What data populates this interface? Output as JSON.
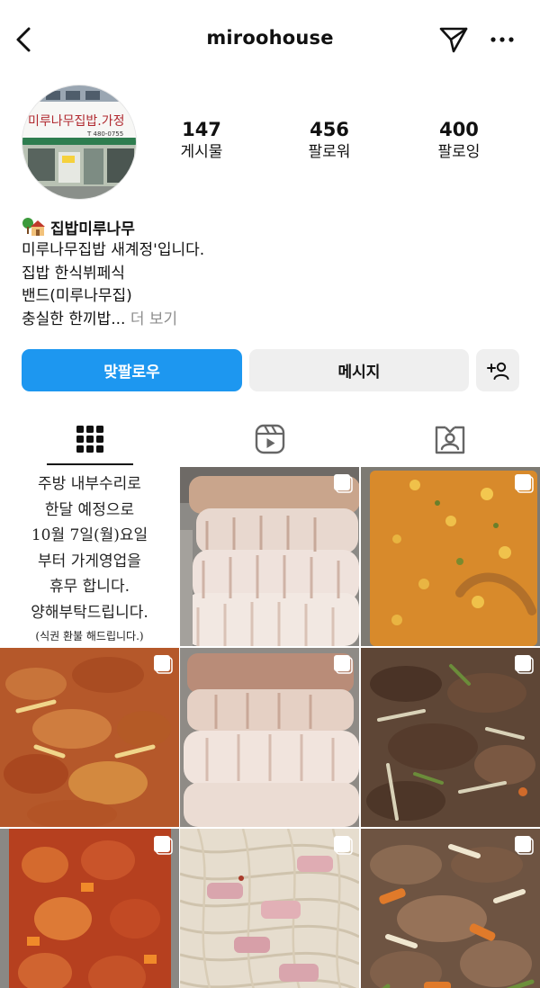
{
  "header": {
    "username": "miroohouse",
    "icons": {
      "back": "chevron-left-icon",
      "send": "paper-plane-icon",
      "more": "more-horizontal-icon"
    }
  },
  "profile": {
    "avatar_sign_text": "미루나무집밥.가정",
    "avatar_phone": "T 480-0755",
    "stats": [
      {
        "value": "147",
        "label": "게시물"
      },
      {
        "value": "456",
        "label": "팔로워"
      },
      {
        "value": "400",
        "label": "팔로잉"
      }
    ],
    "bio": {
      "name": "집밥미루나무",
      "name_icon": "house-with-tree-icon",
      "lines": [
        "미루나무집밥 새계정'입니다.",
        "집밥 한식뷔페식",
        "밴드(미루나무집)"
      ],
      "last_line": "충실한 한끼밥...",
      "more": "더 보기"
    }
  },
  "actions": {
    "follow_back": "맞팔로우",
    "message": "메시지",
    "add_user_icon": "add-user-icon"
  },
  "tabs": {
    "icons": [
      "grid-icon",
      "reels-icon",
      "tagged-icon"
    ],
    "active": "grid"
  },
  "posts": {
    "notice": {
      "lines": [
        "주방 내부수리로",
        "한달 예정으로",
        "10월 7일(월)요일",
        "부터 가게영업을",
        "휴무 합니다.",
        "양해부탁드립니다."
      ],
      "small": "(식권 환불 해드립니다.)"
    },
    "photos": [
      "sliced-pork-boiled",
      "curry-stew",
      "spicy-stir-fried-pork",
      "sliced-pork-boiled",
      "bulgogi-beef",
      "spicy-braised-chicken",
      "pasta-with-bacon",
      "stir-fried-beef-vegetables"
    ],
    "colors": {
      "follow_button": "#1d97f0",
      "secondary_button": "#efefef"
    }
  }
}
